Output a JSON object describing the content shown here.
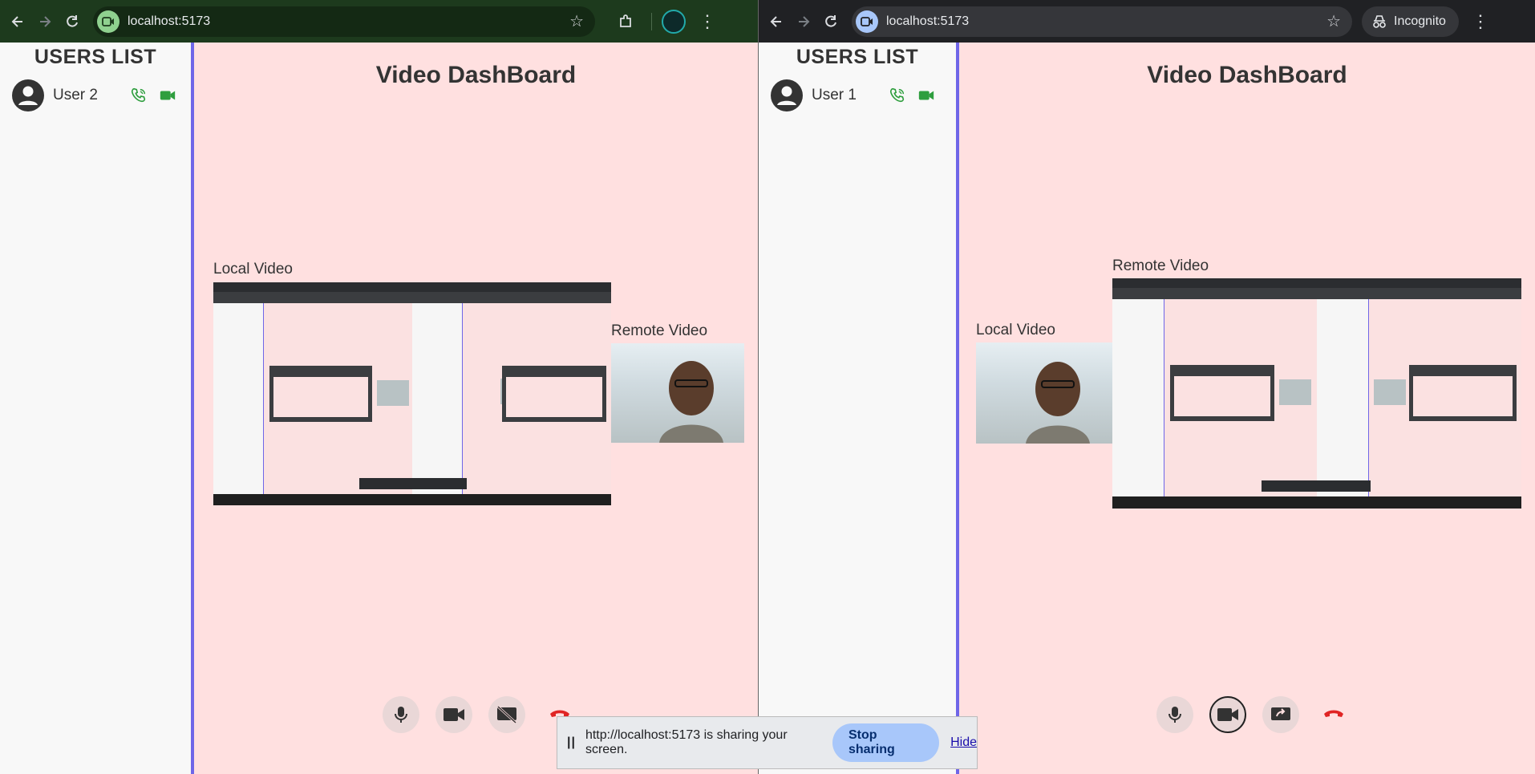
{
  "left_window": {
    "url": "localhost:5173",
    "sidebar": {
      "title": "USERS LIST",
      "users": [
        {
          "name": "User 2"
        }
      ]
    },
    "main": {
      "title": "Video DashBoard",
      "local_label": "Local Video",
      "remote_label": "Remote Video"
    }
  },
  "right_window": {
    "url": "localhost:5173",
    "incognito_label": "Incognito",
    "sidebar": {
      "title": "USERS LIST",
      "users": [
        {
          "name": "User 1"
        }
      ]
    },
    "main": {
      "title": "Video DashBoard",
      "local_label": "Local Video",
      "remote_label": "Remote Video"
    }
  },
  "share_bar": {
    "message": "http://localhost:5173 is sharing your screen.",
    "stop_label": "Stop sharing",
    "hide_label": "Hide"
  },
  "colors": {
    "call_green": "#2e9e3e",
    "hangup_red": "#e02424",
    "sidebar_border": "#6f66e8",
    "main_bg": "#ffe0e0"
  }
}
